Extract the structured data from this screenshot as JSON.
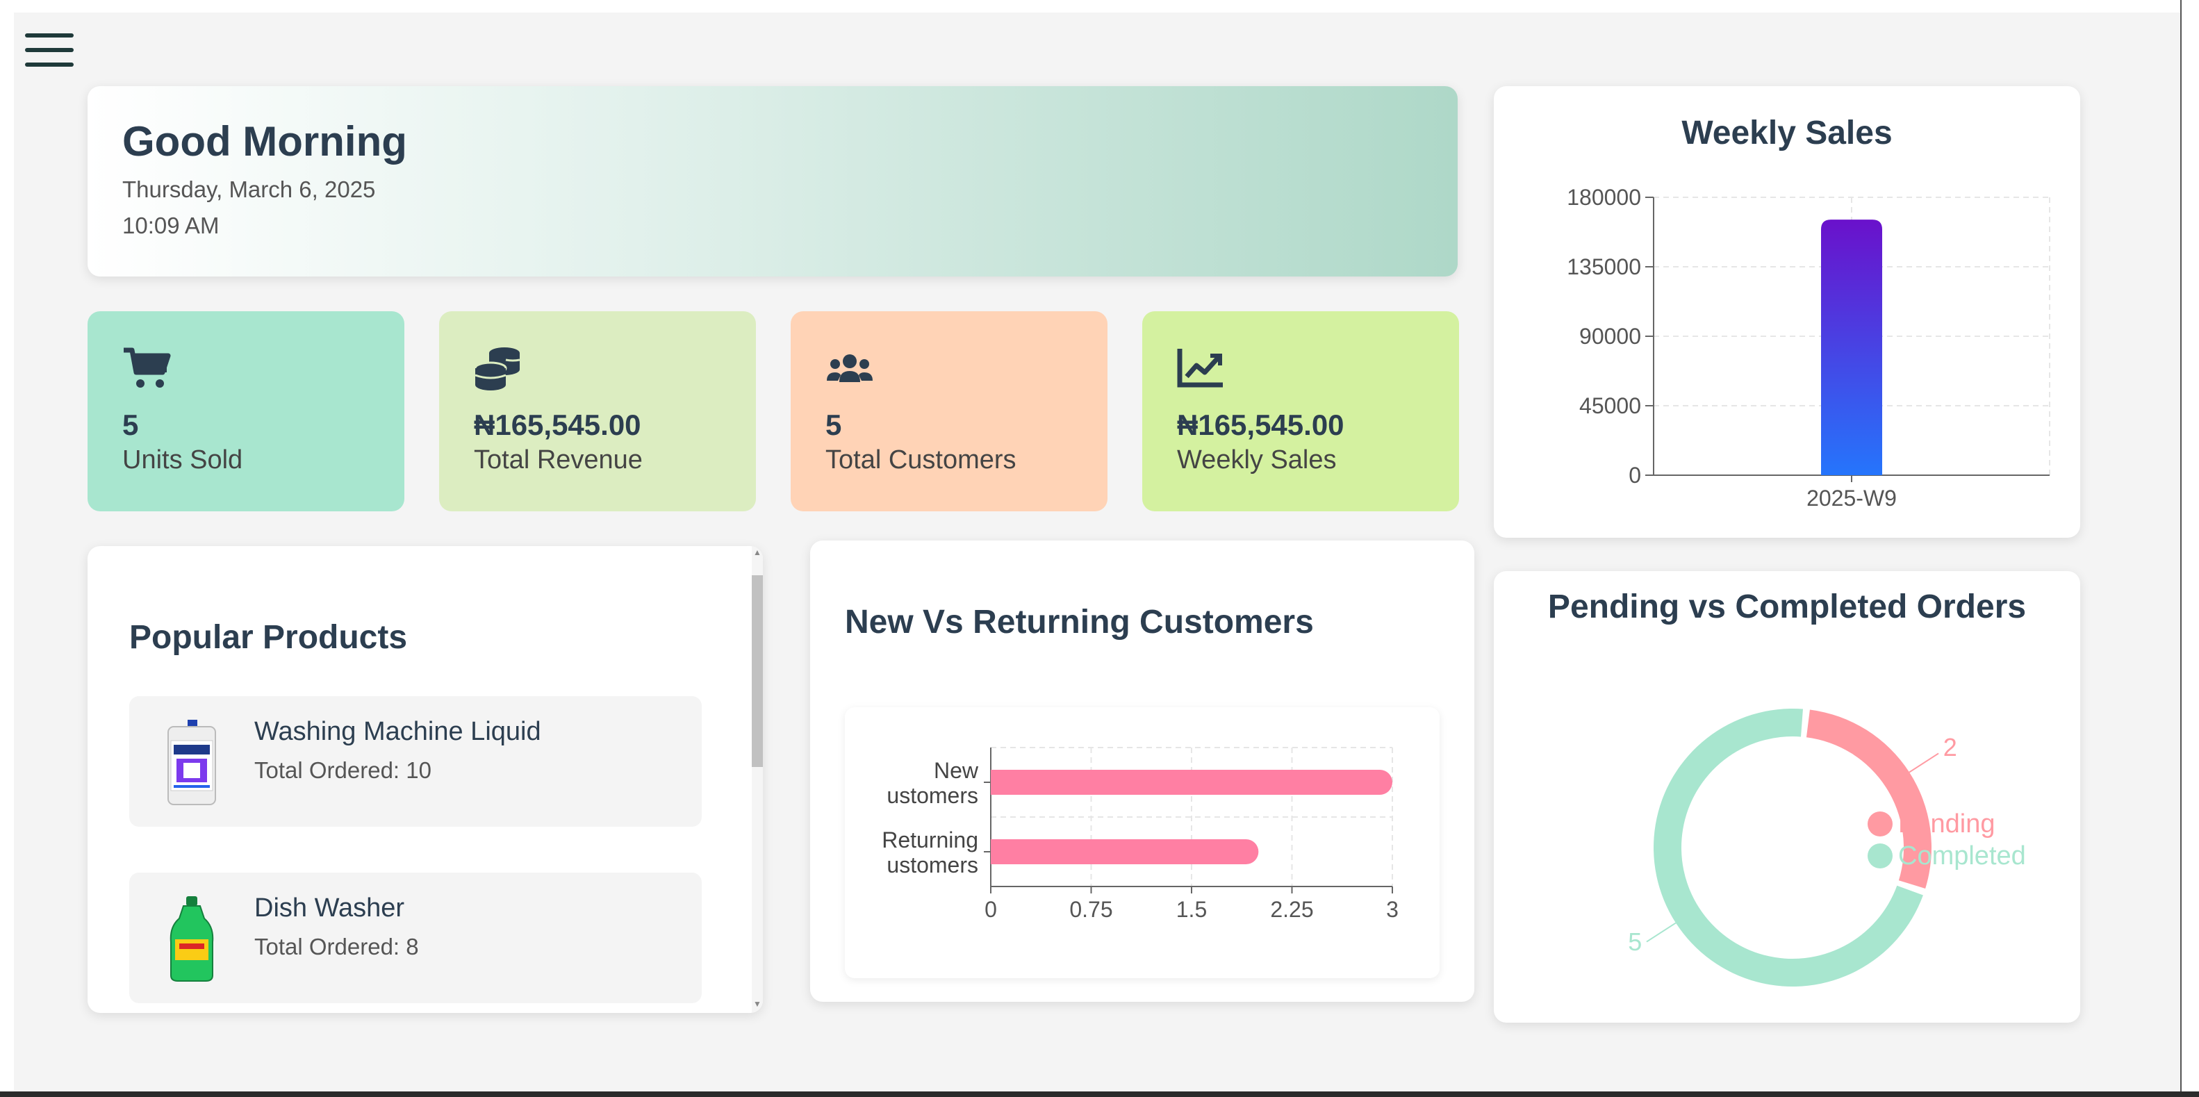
{
  "greeting": {
    "title": "Good Morning",
    "date": "Thursday, March 6, 2025",
    "time": "10:09 AM"
  },
  "stats": [
    {
      "icon": "cart-icon",
      "value": "5",
      "label": "Units Sold",
      "color": "#a8e6cf"
    },
    {
      "icon": "coins-icon",
      "value": "₦165,545.00",
      "label": "Total Revenue",
      "color": "#dcedc1"
    },
    {
      "icon": "users-icon",
      "value": "5",
      "label": "Total Customers",
      "color": "#ffd3b6"
    },
    {
      "icon": "chart-line-icon",
      "value": "₦165,545.00",
      "label": "Weekly Sales",
      "color": "#d4f1a0"
    }
  ],
  "popular": {
    "title": "Popular Products",
    "items": [
      {
        "name": "Washing Machine Liquid",
        "ordered": "Total Ordered: 10"
      },
      {
        "name": "Dish Washer",
        "ordered": "Total Ordered: 8"
      }
    ]
  },
  "chart_data": [
    {
      "type": "bar",
      "title": "Weekly Sales",
      "categories": [
        "2025-W9"
      ],
      "values": [
        165545
      ],
      "ylim": [
        0,
        180000
      ],
      "yticks": [
        "180000",
        "135000",
        "90000",
        "45000",
        "0"
      ],
      "grid": true,
      "colors": [
        "#6a11cb",
        "#2575fc"
      ]
    },
    {
      "type": "bar",
      "orientation": "horizontal",
      "title": "New Vs Returning Customers",
      "categories": [
        "New Customers",
        "Returning Customers"
      ],
      "category_labels": [
        [
          "New",
          "ustomers"
        ],
        [
          "Returning",
          "ustomers"
        ]
      ],
      "values": [
        3,
        2
      ],
      "xlim": [
        0,
        3
      ],
      "xticks": [
        "0",
        "0.75",
        "1.5",
        "2.25",
        "3"
      ],
      "grid": true,
      "color": "#ff7fa3"
    },
    {
      "type": "pie",
      "donut": true,
      "title": "Pending vs Completed Orders",
      "labels": [
        "Pending",
        "Completed"
      ],
      "values": [
        2,
        5
      ],
      "colors": [
        "#ff9aa2",
        "#a8e6cf"
      ],
      "legend": "right"
    }
  ]
}
